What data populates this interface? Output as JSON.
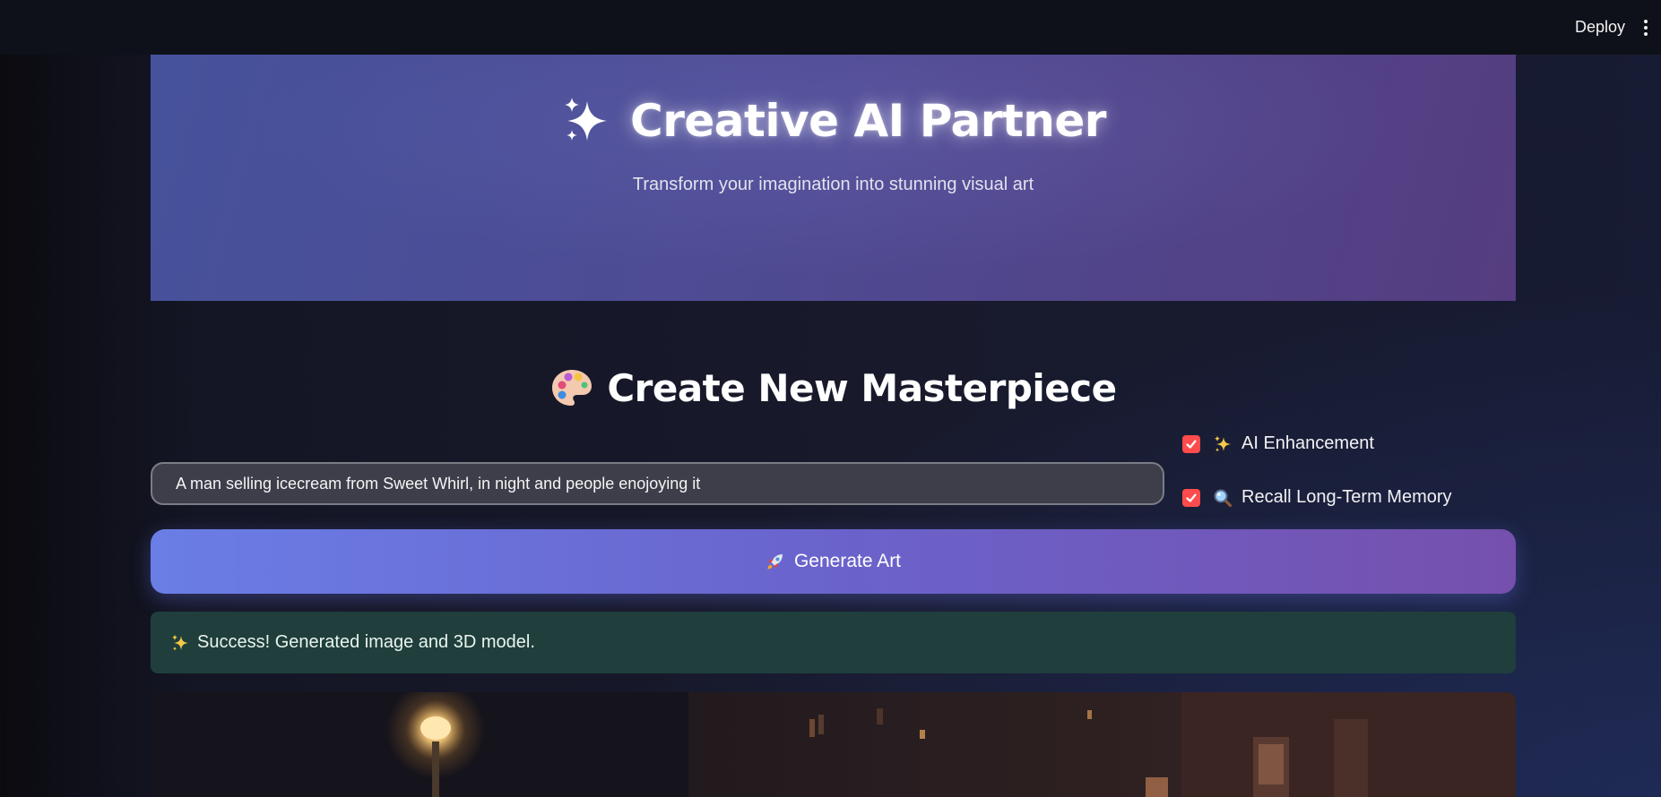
{
  "topbar": {
    "deploy_label": "Deploy",
    "menu_icon": "vertical-ellipsis-icon"
  },
  "hero": {
    "title": "Creative AI Partner",
    "title_icon": "sparkles-icon",
    "subtitle": "Transform your imagination into stunning visual art"
  },
  "section": {
    "title": "Create New Masterpiece",
    "title_icon": "artist-palette-icon"
  },
  "prompt": {
    "value": "A man selling icecream from Sweet Whirl, in night and people enojoying it"
  },
  "options": [
    {
      "label": "AI Enhancement",
      "icon": "sparkles-icon",
      "checked": true
    },
    {
      "label": "Recall Long-Term Memory",
      "icon": "magnifying-glass-icon",
      "checked": true
    }
  ],
  "generate": {
    "label": "Generate Art",
    "icon": "rocket-icon"
  },
  "status": {
    "message": "Success! Generated image and 3D model.",
    "icon": "sparkles-icon"
  },
  "colors": {
    "checkbox": "#ff4b4b",
    "hero_gradient_start": "#46529c",
    "hero_gradient_end": "#553d80",
    "button_gradient_start": "#6a7ee6",
    "button_gradient_end": "#7650ad",
    "success_bg": "#1f3e3c"
  }
}
